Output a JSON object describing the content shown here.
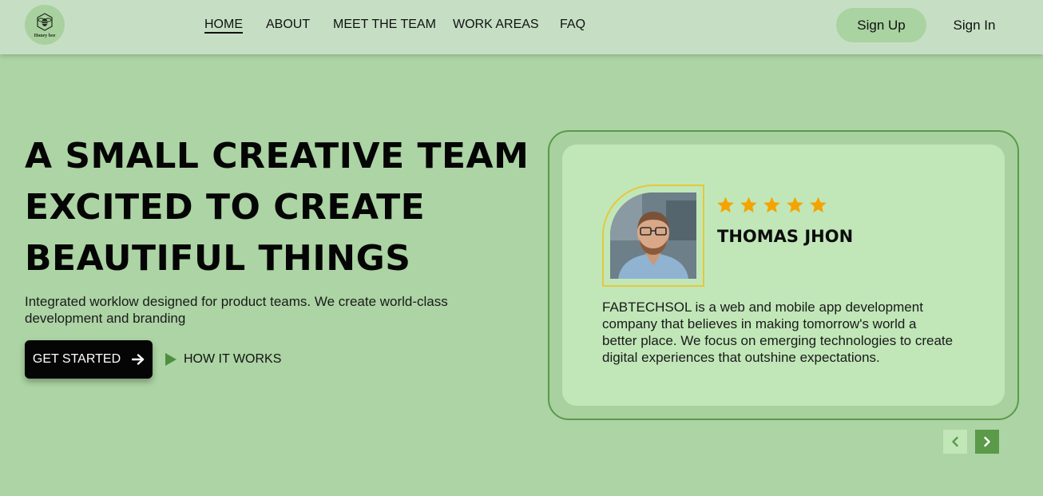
{
  "brand": {
    "logo_text": "Honey bee",
    "logo_icon": "bee-icon"
  },
  "nav": {
    "links": [
      {
        "label": "HOME",
        "active": true
      },
      {
        "label": "ABOUT",
        "active": false
      },
      {
        "label": "MEET THE TEAM",
        "active": false
      },
      {
        "label": "WORK AREAS",
        "active": false
      },
      {
        "label": "FAQ",
        "active": false
      }
    ],
    "signup_label": "Sign Up",
    "signin_label": "Sign In"
  },
  "hero": {
    "title_lines": [
      "A SMALL CREATIVE TEAM",
      "EXCITED TO CREATE",
      "BEAUTIFUL THINGS"
    ],
    "description": "Integrated worklow designed for product teams. We create world-class development and branding",
    "cta_primary": "GET STARTED",
    "cta_primary_icon": "arrow-right-icon",
    "cta_secondary": "HOW IT WORKS",
    "cta_secondary_icon": "play-icon"
  },
  "testimonial": {
    "rating": 5,
    "rating_max": 5,
    "name": "THOMAS JHON",
    "text": "FABTECHSOL is a web and mobile app development company that believes in making tomorrow's world a better place. We focus on emerging technologies to create digital experiences that outshine expectations.",
    "prev_icon": "chevron-left-icon",
    "next_icon": "chevron-right-icon"
  },
  "colors": {
    "page_bg": "#acd4a4",
    "nav_bg": "#c6dfc4",
    "card_inner_bg": "#c1e7b8",
    "accent_green": "#5a9a49",
    "star": "#f5a300",
    "frame_yellow": "#e5c83a"
  }
}
